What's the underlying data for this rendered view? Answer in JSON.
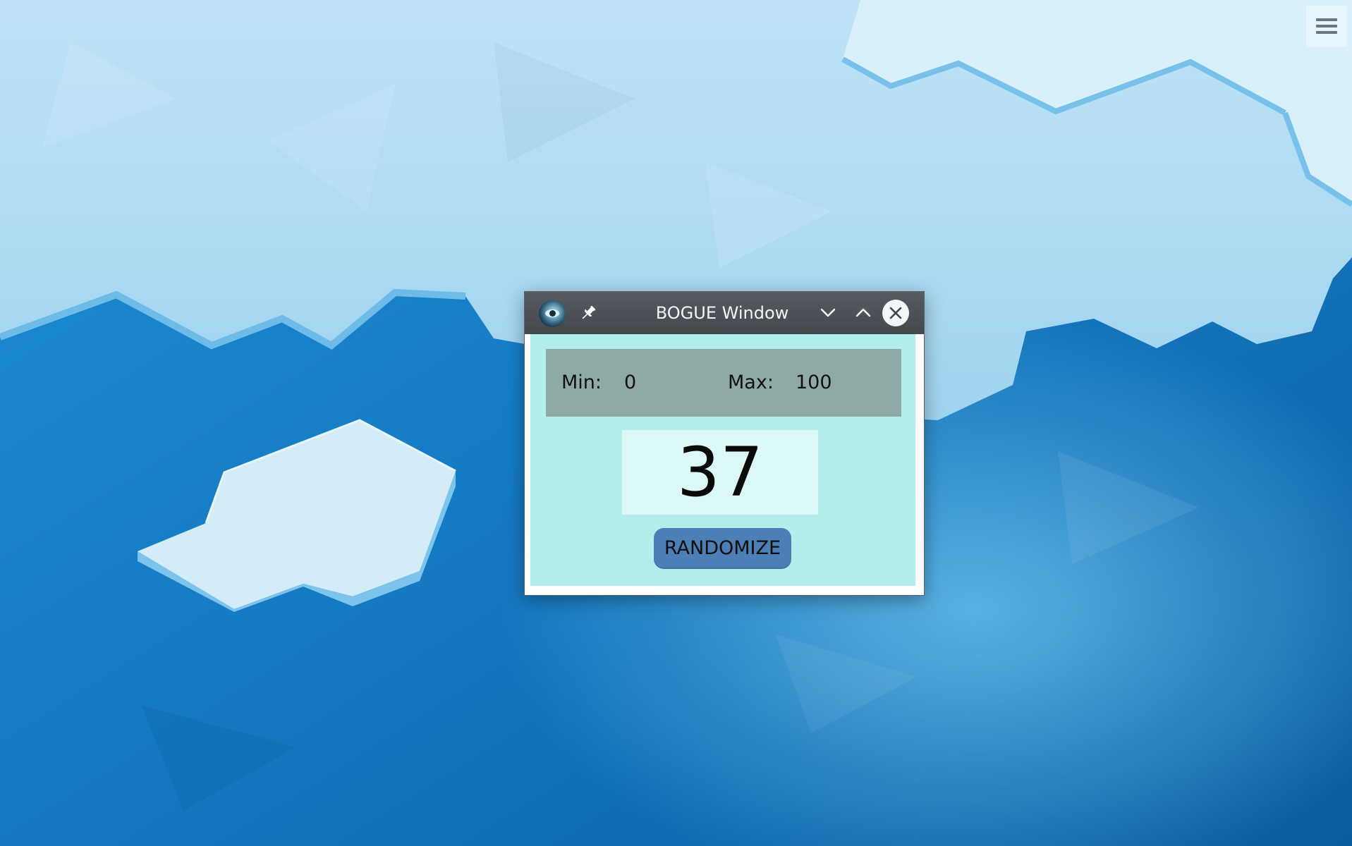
{
  "desktop": {
    "menu_icon": "hamburger-menu-icon"
  },
  "window": {
    "title": "BOGUE Window",
    "icons": {
      "app": "app-logo-icon",
      "pin": "pin-icon",
      "minimize": "chevron-down-icon",
      "maximize": "chevron-up-icon",
      "close": "close-icon"
    }
  },
  "range": {
    "min_label": "Min:",
    "min_value": "0",
    "max_label": "Max:",
    "max_value": "100"
  },
  "result": {
    "value": "37"
  },
  "actions": {
    "randomize_label": "RANDOMIZE"
  },
  "colors": {
    "content_bg": "#b3eeed",
    "panel_bg": "#8fa9a7",
    "display_bg": "#dbf8f6",
    "button_bg": "#4b7fb5",
    "titlebar_bg": "#4b5055"
  }
}
